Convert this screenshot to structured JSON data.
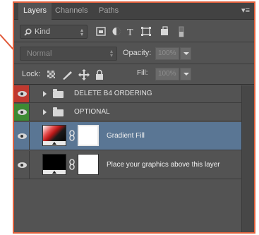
{
  "tabs": [
    {
      "label": "Layers",
      "active": true
    },
    {
      "label": "Channels",
      "active": false
    },
    {
      "label": "Paths",
      "active": false
    }
  ],
  "panel_menu_icon": "panel-menu-icon",
  "filter": {
    "kind_label": "Kind",
    "icons": [
      "pixel-layer-filter-icon",
      "adjustment-layer-filter-icon",
      "type-layer-filter-icon",
      "shape-layer-filter-icon",
      "smart-object-filter-icon",
      "filter-toggle-icon"
    ]
  },
  "blend": {
    "mode": "Normal",
    "opacity_label": "Opacity:",
    "opacity_value": "100%"
  },
  "lock": {
    "label": "Lock:",
    "icons": [
      "lock-transparent-pixels-icon",
      "lock-image-pixels-icon",
      "lock-position-icon",
      "lock-all-icon"
    ],
    "fill_label": "Fill:",
    "fill_value": "100%"
  },
  "layers": [
    {
      "name": "DELETE B4 ORDERING",
      "kind": "group",
      "visibility_color": "#c0392f"
    },
    {
      "name": "OPTIONAL",
      "kind": "group",
      "visibility_color": "#3e8a34"
    },
    {
      "name": "Gradient Fill",
      "kind": "fill",
      "selected": true
    },
    {
      "name": "Place your graphics above this layer",
      "kind": "layer"
    }
  ],
  "colors": {
    "panel_bg": "#535353",
    "selected_row": "#5a7694",
    "highlight_border": "#e2623f"
  }
}
